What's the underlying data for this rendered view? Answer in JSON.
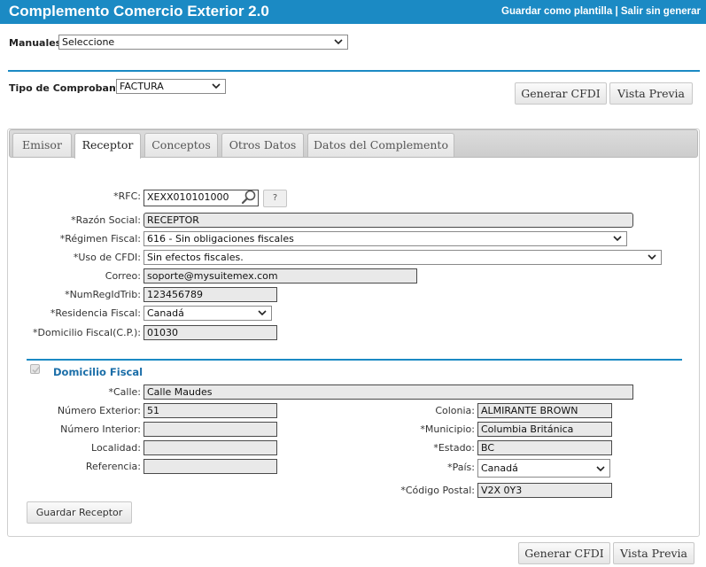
{
  "header": {
    "title": "Complemento Comercio Exterior 2.0",
    "save_template": "Guardar como plantilla",
    "separator": " | ",
    "exit": "Salir sin generar"
  },
  "manuales": {
    "label": "Manuales:",
    "value": "Seleccione"
  },
  "tipo_comprobante": {
    "label": "Tipo de Comprobante:",
    "value": "FACTURA"
  },
  "buttons": {
    "generar_cfdi": "Generar CFDI",
    "vista_previa": "Vista Previa",
    "guardar_receptor": "Guardar Receptor",
    "help": "?"
  },
  "tabs": [
    {
      "label": "Emisor",
      "active": false
    },
    {
      "label": "Receptor",
      "active": true
    },
    {
      "label": "Conceptos",
      "active": false
    },
    {
      "label": "Otros Datos",
      "active": false
    },
    {
      "label": "Datos del Complemento",
      "active": false
    }
  ],
  "receptor": {
    "rfc": {
      "label": "*RFC:",
      "value": "XEXX010101000"
    },
    "razon_social": {
      "label": "*Razón Social:",
      "value": "RECEPTOR"
    },
    "regimen_fiscal": {
      "label": "*Régimen Fiscal:",
      "value": "616 - Sin obligaciones fiscales"
    },
    "uso_cfdi": {
      "label": "*Uso de CFDI:",
      "value": "Sin efectos fiscales."
    },
    "correo": {
      "label": "Correo:",
      "value": "soporte@mysuitemex.com"
    },
    "num_reg_id_trib": {
      "label": "*NumRegIdTrib:",
      "value": "123456789"
    },
    "residencia_fiscal": {
      "label": "*Residencia Fiscal:",
      "value": "Canadá"
    },
    "domicilio_fiscal_cp": {
      "label": "*Domicilio Fiscal(C.P.):",
      "value": "01030"
    }
  },
  "domicilio": {
    "title": "Domicilio Fiscal",
    "calle": {
      "label": "*Calle:",
      "value": "Calle Maudes"
    },
    "numero_exterior": {
      "label": "Número Exterior:",
      "value": "51"
    },
    "numero_interior": {
      "label": "Número Interior:",
      "value": ""
    },
    "localidad": {
      "label": "Localidad:",
      "value": ""
    },
    "referencia": {
      "label": "Referencia:",
      "value": ""
    },
    "colonia": {
      "label": "Colonia:",
      "value": "ALMIRANTE BROWN"
    },
    "municipio": {
      "label": "*Municipio:",
      "value": "Columbia Británica"
    },
    "estado": {
      "label": "*Estado:",
      "value": "BC"
    },
    "pais": {
      "label": "*País:",
      "value": "Canadá"
    },
    "codigo_postal": {
      "label": "*Código Postal:",
      "value": "V2X 0Y3"
    }
  },
  "colors": {
    "accent": "#1b8ac4",
    "section_title": "#1b6ea8"
  }
}
